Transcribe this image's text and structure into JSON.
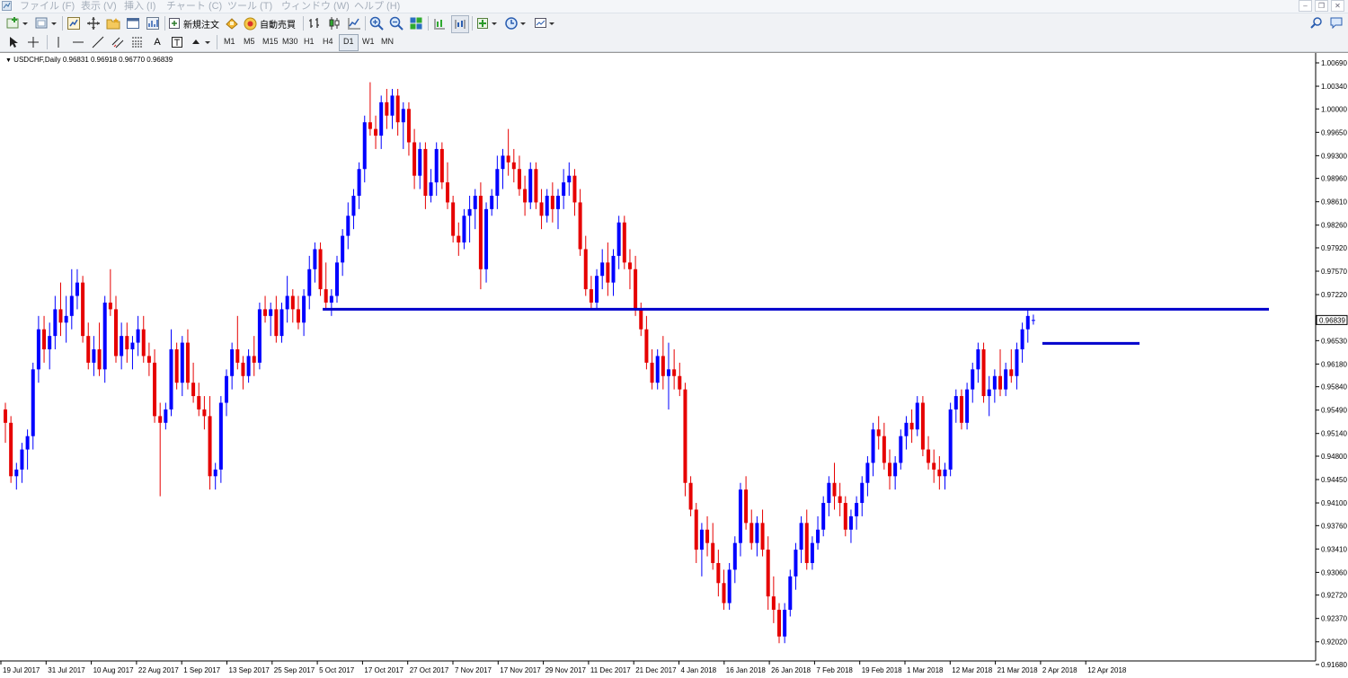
{
  "menu": {
    "items": [
      "ファイル (F)",
      "表示 (V)",
      "挿入 (I)",
      "チャート (C)",
      "ツール (T)",
      "ウィンドウ (W)",
      "ヘルプ (H)"
    ]
  },
  "toolbar": {
    "new_order_label": "新規注文",
    "auto_trade_label": "自動売買",
    "timeframes": [
      "M1",
      "M5",
      "M15",
      "M30",
      "H1",
      "H4",
      "D1",
      "W1",
      "MN"
    ],
    "active_timeframe": "D1"
  },
  "chart_header": {
    "symbol": "USDCHF,Daily",
    "ohlc": "0.96831 0.96918 0.96770 0.96839"
  },
  "chart_data": {
    "type": "candlestick",
    "symbol": "USDCHF",
    "timeframe": "Daily",
    "colors": {
      "bull": "#0000ff",
      "bear": "#e60000",
      "hline": "#0000cc"
    },
    "ylim": [
      0.9168,
      1.0069
    ],
    "y_ticks": [
      "1.00690",
      "1.00340",
      "1.00000",
      "0.99650",
      "0.99300",
      "0.98960",
      "0.98610",
      "0.98260",
      "0.97920",
      "0.97570",
      "0.97220",
      "0.96870",
      "0.96530",
      "0.96180",
      "0.95840",
      "0.95490",
      "0.95140",
      "0.94800",
      "0.94450",
      "0.94100",
      "0.93760",
      "0.93410",
      "0.93060",
      "0.92720",
      "0.92370",
      "0.92020",
      "0.91680"
    ],
    "x_ticks": [
      "19 Jul 2017",
      "31 Jul 2017",
      "10 Aug 2017",
      "22 Aug 2017",
      "1 Sep 2017",
      "13 Sep 2017",
      "25 Sep 2017",
      "5 Oct 2017",
      "17 Oct 2017",
      "27 Oct 2017",
      "7 Nov 2017",
      "17 Nov 2017",
      "29 Nov 2017",
      "11 Dec 2017",
      "21 Dec 2017",
      "4 Jan 2018",
      "16 Jan 2018",
      "26 Jan 2018",
      "7 Feb 2018",
      "19 Feb 2018",
      "1 Mar 2018",
      "12 Mar 2018",
      "21 Mar 2018",
      "2 Apr 2018",
      "12 Apr 2018"
    ],
    "current_price": "0.96839",
    "horizontal_lines": [
      {
        "price": 0.97,
        "from_date": "5 Oct 2017",
        "to": "right-edge"
      },
      {
        "price": 0.9649,
        "from_date": "2 Apr 2018",
        "to": "near-right"
      }
    ],
    "candles": [
      [
        0.955,
        0.956,
        0.95,
        0.953
      ],
      [
        0.953,
        0.954,
        0.944,
        0.945
      ],
      [
        0.945,
        0.947,
        0.943,
        0.946
      ],
      [
        0.946,
        0.95,
        0.944,
        0.949
      ],
      [
        0.949,
        0.952,
        0.946,
        0.951
      ],
      [
        0.951,
        0.962,
        0.949,
        0.961
      ],
      [
        0.961,
        0.969,
        0.959,
        0.967
      ],
      [
        0.967,
        0.969,
        0.962,
        0.964
      ],
      [
        0.964,
        0.968,
        0.961,
        0.966
      ],
      [
        0.966,
        0.972,
        0.964,
        0.97
      ],
      [
        0.97,
        0.974,
        0.966,
        0.968
      ],
      [
        0.968,
        0.972,
        0.965,
        0.969
      ],
      [
        0.969,
        0.976,
        0.967,
        0.972
      ],
      [
        0.972,
        0.976,
        0.97,
        0.974
      ],
      [
        0.974,
        0.975,
        0.965,
        0.966
      ],
      [
        0.966,
        0.968,
        0.961,
        0.962
      ],
      [
        0.962,
        0.966,
        0.96,
        0.964
      ],
      [
        0.964,
        0.968,
        0.96,
        0.961
      ],
      [
        0.961,
        0.972,
        0.959,
        0.971
      ],
      [
        0.971,
        0.976,
        0.969,
        0.97
      ],
      [
        0.97,
        0.972,
        0.962,
        0.963
      ],
      [
        0.963,
        0.968,
        0.961,
        0.966
      ],
      [
        0.966,
        0.968,
        0.962,
        0.964
      ],
      [
        0.964,
        0.966,
        0.961,
        0.965
      ],
      [
        0.965,
        0.969,
        0.963,
        0.967
      ],
      [
        0.967,
        0.969,
        0.962,
        0.963
      ],
      [
        0.963,
        0.965,
        0.96,
        0.962
      ],
      [
        0.962,
        0.964,
        0.953,
        0.954
      ],
      [
        0.954,
        0.956,
        0.942,
        0.953
      ],
      [
        0.953,
        0.956,
        0.952,
        0.955
      ],
      [
        0.955,
        0.967,
        0.954,
        0.964
      ],
      [
        0.964,
        0.965,
        0.958,
        0.959
      ],
      [
        0.959,
        0.966,
        0.957,
        0.965
      ],
      [
        0.965,
        0.967,
        0.958,
        0.959
      ],
      [
        0.959,
        0.962,
        0.956,
        0.957
      ],
      [
        0.957,
        0.959,
        0.954,
        0.955
      ],
      [
        0.955,
        0.957,
        0.952,
        0.954
      ],
      [
        0.954,
        0.957,
        0.943,
        0.945
      ],
      [
        0.945,
        0.947,
        0.943,
        0.946
      ],
      [
        0.946,
        0.957,
        0.944,
        0.956
      ],
      [
        0.956,
        0.961,
        0.954,
        0.96
      ],
      [
        0.96,
        0.965,
        0.958,
        0.964
      ],
      [
        0.964,
        0.969,
        0.961,
        0.962
      ],
      [
        0.962,
        0.963,
        0.958,
        0.96
      ],
      [
        0.96,
        0.964,
        0.959,
        0.963
      ],
      [
        0.963,
        0.966,
        0.96,
        0.962
      ],
      [
        0.962,
        0.971,
        0.961,
        0.97
      ],
      [
        0.97,
        0.972,
        0.968,
        0.969
      ],
      [
        0.969,
        0.971,
        0.966,
        0.97
      ],
      [
        0.97,
        0.972,
        0.965,
        0.966
      ],
      [
        0.966,
        0.971,
        0.965,
        0.97
      ],
      [
        0.97,
        0.975,
        0.968,
        0.972
      ],
      [
        0.972,
        0.973,
        0.968,
        0.97
      ],
      [
        0.97,
        0.972,
        0.967,
        0.968
      ],
      [
        0.968,
        0.973,
        0.966,
        0.972
      ],
      [
        0.972,
        0.978,
        0.97,
        0.976
      ],
      [
        0.976,
        0.98,
        0.974,
        0.979
      ],
      [
        0.979,
        0.98,
        0.972,
        0.973
      ],
      [
        0.973,
        0.977,
        0.97,
        0.971
      ],
      [
        0.971,
        0.973,
        0.969,
        0.972
      ],
      [
        0.972,
        0.978,
        0.971,
        0.977
      ],
      [
        0.977,
        0.982,
        0.975,
        0.981
      ],
      [
        0.981,
        0.986,
        0.979,
        0.984
      ],
      [
        0.984,
        0.988,
        0.982,
        0.987
      ],
      [
        0.987,
        0.992,
        0.985,
        0.991
      ],
      [
        0.991,
        0.999,
        0.989,
        0.998
      ],
      [
        0.998,
        1.004,
        0.996,
        0.997
      ],
      [
        0.997,
        0.999,
        0.994,
        0.996
      ],
      [
        0.996,
        1.002,
        0.994,
        1.001
      ],
      [
        1.001,
        1.003,
        0.997,
        0.999
      ],
      [
        0.999,
        1.003,
        0.997,
        1.002
      ],
      [
        1.002,
        1.003,
        0.996,
        0.998
      ],
      [
        0.998,
        1.001,
        0.994,
        1.0
      ],
      [
        1.0,
        1.001,
        0.993,
        0.995
      ],
      [
        0.995,
        0.997,
        0.988,
        0.99
      ],
      [
        0.99,
        0.995,
        0.988,
        0.994
      ],
      [
        0.994,
        0.995,
        0.985,
        0.987
      ],
      [
        0.987,
        0.991,
        0.986,
        0.989
      ],
      [
        0.989,
        0.995,
        0.987,
        0.994
      ],
      [
        0.994,
        0.995,
        0.988,
        0.989
      ],
      [
        0.989,
        0.992,
        0.985,
        0.986
      ],
      [
        0.986,
        0.987,
        0.98,
        0.981
      ],
      [
        0.981,
        0.983,
        0.978,
        0.98
      ],
      [
        0.98,
        0.985,
        0.979,
        0.984
      ],
      [
        0.984,
        0.987,
        0.98,
        0.985
      ],
      [
        0.985,
        0.988,
        0.982,
        0.987
      ],
      [
        0.987,
        0.989,
        0.973,
        0.976
      ],
      [
        0.976,
        0.986,
        0.974,
        0.985
      ],
      [
        0.985,
        0.988,
        0.984,
        0.987
      ],
      [
        0.987,
        0.993,
        0.985,
        0.991
      ],
      [
        0.991,
        0.994,
        0.988,
        0.993
      ],
      [
        0.993,
        0.997,
        0.99,
        0.992
      ],
      [
        0.992,
        0.994,
        0.989,
        0.991
      ],
      [
        0.991,
        0.993,
        0.987,
        0.988
      ],
      [
        0.988,
        0.99,
        0.984,
        0.986
      ],
      [
        0.986,
        0.992,
        0.985,
        0.991
      ],
      [
        0.991,
        0.992,
        0.985,
        0.986
      ],
      [
        0.986,
        0.988,
        0.982,
        0.984
      ],
      [
        0.984,
        0.988,
        0.983,
        0.987
      ],
      [
        0.987,
        0.989,
        0.983,
        0.985
      ],
      [
        0.985,
        0.988,
        0.982,
        0.987
      ],
      [
        0.987,
        0.991,
        0.985,
        0.989
      ],
      [
        0.989,
        0.992,
        0.987,
        0.99
      ],
      [
        0.99,
        0.991,
        0.984,
        0.986
      ],
      [
        0.986,
        0.988,
        0.978,
        0.979
      ],
      [
        0.979,
        0.981,
        0.972,
        0.973
      ],
      [
        0.973,
        0.975,
        0.97,
        0.971
      ],
      [
        0.971,
        0.976,
        0.97,
        0.975
      ],
      [
        0.975,
        0.979,
        0.973,
        0.977
      ],
      [
        0.977,
        0.98,
        0.972,
        0.974
      ],
      [
        0.974,
        0.979,
        0.972,
        0.978
      ],
      [
        0.978,
        0.984,
        0.976,
        0.983
      ],
      [
        0.983,
        0.984,
        0.976,
        0.977
      ],
      [
        0.977,
        0.979,
        0.973,
        0.976
      ],
      [
        0.976,
        0.978,
        0.969,
        0.97
      ],
      [
        0.97,
        0.971,
        0.966,
        0.967
      ],
      [
        0.967,
        0.969,
        0.961,
        0.962
      ],
      [
        0.962,
        0.964,
        0.958,
        0.959
      ],
      [
        0.959,
        0.964,
        0.958,
        0.963
      ],
      [
        0.963,
        0.966,
        0.958,
        0.96
      ],
      [
        0.96,
        0.965,
        0.955,
        0.961
      ],
      [
        0.961,
        0.964,
        0.958,
        0.96
      ],
      [
        0.96,
        0.962,
        0.957,
        0.958
      ],
      [
        0.958,
        0.959,
        0.942,
        0.944
      ],
      [
        0.944,
        0.945,
        0.939,
        0.94
      ],
      [
        0.94,
        0.941,
        0.932,
        0.934
      ],
      [
        0.934,
        0.938,
        0.93,
        0.937
      ],
      [
        0.937,
        0.939,
        0.933,
        0.935
      ],
      [
        0.935,
        0.938,
        0.931,
        0.932
      ],
      [
        0.932,
        0.934,
        0.927,
        0.929
      ],
      [
        0.929,
        0.931,
        0.925,
        0.926
      ],
      [
        0.926,
        0.932,
        0.925,
        0.931
      ],
      [
        0.931,
        0.936,
        0.929,
        0.935
      ],
      [
        0.935,
        0.944,
        0.933,
        0.943
      ],
      [
        0.943,
        0.945,
        0.937,
        0.938
      ],
      [
        0.938,
        0.94,
        0.934,
        0.935
      ],
      [
        0.935,
        0.939,
        0.933,
        0.938
      ],
      [
        0.938,
        0.94,
        0.933,
        0.934
      ],
      [
        0.934,
        0.936,
        0.925,
        0.927
      ],
      [
        0.927,
        0.93,
        0.923,
        0.925
      ],
      [
        0.925,
        0.926,
        0.92,
        0.921
      ],
      [
        0.921,
        0.926,
        0.92,
        0.925
      ],
      [
        0.925,
        0.931,
        0.924,
        0.93
      ],
      [
        0.93,
        0.935,
        0.928,
        0.934
      ],
      [
        0.934,
        0.939,
        0.932,
        0.938
      ],
      [
        0.938,
        0.94,
        0.931,
        0.932
      ],
      [
        0.932,
        0.936,
        0.931,
        0.935
      ],
      [
        0.935,
        0.939,
        0.934,
        0.937
      ],
      [
        0.937,
        0.942,
        0.936,
        0.941
      ],
      [
        0.941,
        0.945,
        0.939,
        0.944
      ],
      [
        0.944,
        0.947,
        0.94,
        0.942
      ],
      [
        0.942,
        0.944,
        0.939,
        0.941
      ],
      [
        0.941,
        0.942,
        0.936,
        0.937
      ],
      [
        0.937,
        0.94,
        0.935,
        0.939
      ],
      [
        0.939,
        0.942,
        0.937,
        0.941
      ],
      [
        0.941,
        0.945,
        0.939,
        0.944
      ],
      [
        0.944,
        0.948,
        0.942,
        0.947
      ],
      [
        0.947,
        0.953,
        0.945,
        0.952
      ],
      [
        0.952,
        0.954,
        0.949,
        0.951
      ],
      [
        0.951,
        0.953,
        0.946,
        0.947
      ],
      [
        0.947,
        0.949,
        0.943,
        0.945
      ],
      [
        0.945,
        0.948,
        0.943,
        0.947
      ],
      [
        0.947,
        0.952,
        0.946,
        0.951
      ],
      [
        0.951,
        0.954,
        0.949,
        0.953
      ],
      [
        0.953,
        0.955,
        0.95,
        0.952
      ],
      [
        0.952,
        0.957,
        0.951,
        0.956
      ],
      [
        0.956,
        0.957,
        0.948,
        0.949
      ],
      [
        0.949,
        0.951,
        0.946,
        0.947
      ],
      [
        0.947,
        0.949,
        0.944,
        0.946
      ],
      [
        0.946,
        0.948,
        0.943,
        0.945
      ],
      [
        0.945,
        0.947,
        0.943,
        0.946
      ],
      [
        0.946,
        0.956,
        0.945,
        0.955
      ],
      [
        0.955,
        0.958,
        0.953,
        0.957
      ],
      [
        0.957,
        0.958,
        0.952,
        0.953
      ],
      [
        0.953,
        0.959,
        0.952,
        0.958
      ],
      [
        0.958,
        0.962,
        0.956,
        0.961
      ],
      [
        0.961,
        0.965,
        0.959,
        0.964
      ],
      [
        0.964,
        0.965,
        0.956,
        0.957
      ],
      [
        0.957,
        0.96,
        0.954,
        0.958
      ],
      [
        0.958,
        0.961,
        0.956,
        0.96
      ],
      [
        0.96,
        0.964,
        0.957,
        0.958
      ],
      [
        0.958,
        0.962,
        0.957,
        0.961
      ],
      [
        0.961,
        0.964,
        0.959,
        0.96
      ],
      [
        0.96,
        0.965,
        0.958,
        0.964
      ],
      [
        0.964,
        0.968,
        0.962,
        0.967
      ],
      [
        0.967,
        0.97,
        0.965,
        0.969
      ],
      [
        0.9683,
        0.9692,
        0.9677,
        0.9684
      ]
    ]
  }
}
